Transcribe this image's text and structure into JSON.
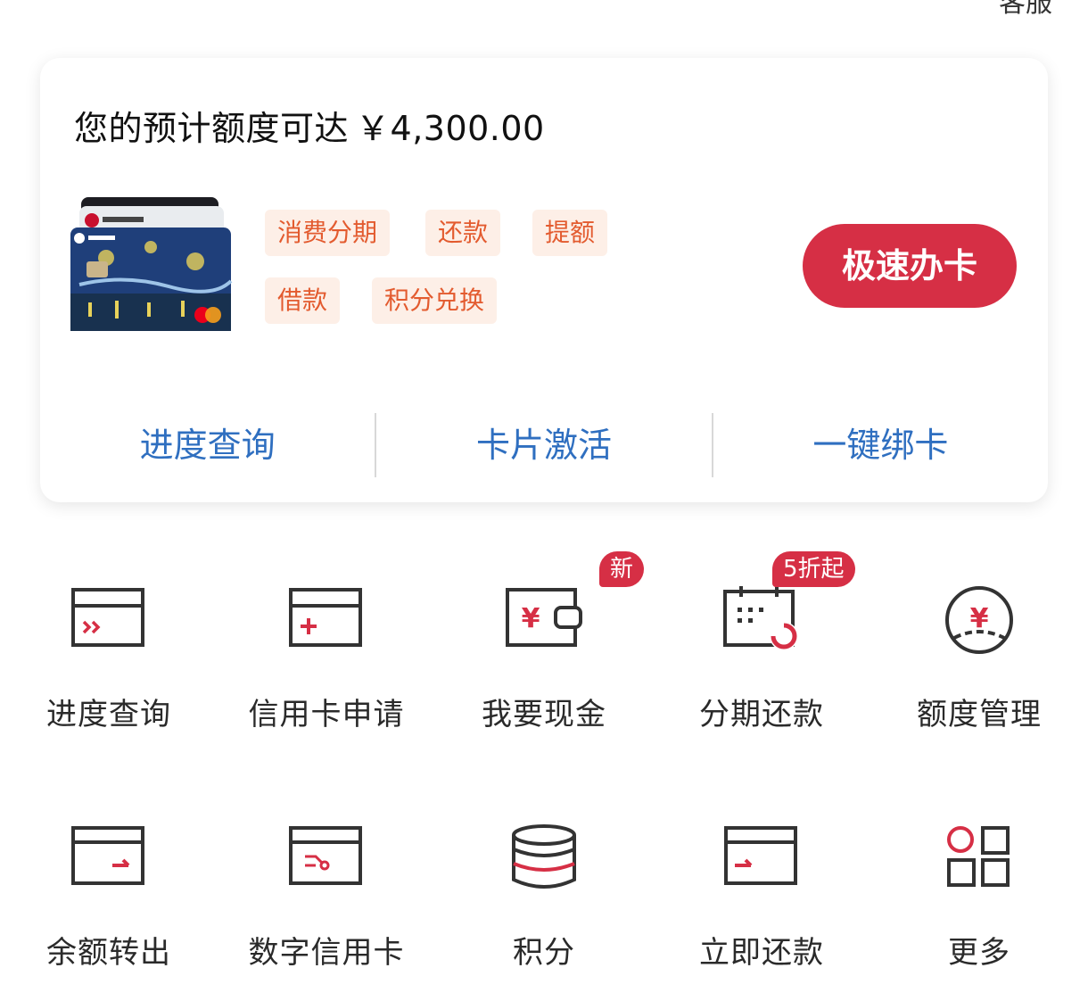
{
  "header": {
    "top_text": "客服"
  },
  "card": {
    "limit_text": "您的预计额度可达",
    "limit_amount": "￥4,300.00",
    "tags": [
      "消费分期",
      "还款",
      "提额",
      "借款",
      "积分兑换"
    ],
    "apply_button": "极速办卡",
    "quick_links": [
      "进度查询",
      "卡片激活",
      "一键绑卡"
    ]
  },
  "grid": {
    "items": [
      {
        "label": "进度查询",
        "icon": "progress-card-icon"
      },
      {
        "label": "信用卡申请",
        "icon": "card-plus-icon"
      },
      {
        "label": "我要现金",
        "icon": "wallet-yen-icon",
        "badge": "新"
      },
      {
        "label": "分期还款",
        "icon": "calendar-icon",
        "badge": "5折起"
      },
      {
        "label": "额度管理",
        "icon": "yen-circle-icon"
      },
      {
        "label": "余额转出",
        "icon": "card-arrow-icon"
      },
      {
        "label": "数字信用卡",
        "icon": "digital-card-icon"
      },
      {
        "label": "积分",
        "icon": "coin-stack-icon"
      },
      {
        "label": "立即还款",
        "icon": "card-repay-icon"
      },
      {
        "label": "更多",
        "icon": "grid-more-icon"
      }
    ]
  },
  "colors": {
    "accent_red": "#d62f45",
    "tag_text": "#e35b2f",
    "tag_bg": "#fdefe7",
    "link_blue": "#2f6fc0"
  }
}
